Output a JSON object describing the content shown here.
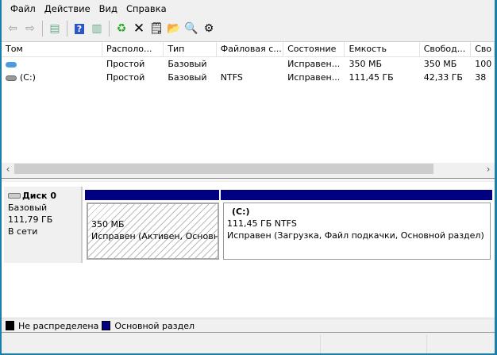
{
  "menu": [
    "Файл",
    "Действие",
    "Вид",
    "Справка"
  ],
  "toolbar": [
    {
      "icon": "back-icon"
    },
    {
      "icon": "forward-icon"
    },
    {
      "icon": "console-tree-icon"
    },
    {
      "icon": "help-icon"
    },
    {
      "icon": "action-pane-icon"
    },
    {
      "icon": "refresh-icon"
    },
    {
      "icon": "delete-icon"
    },
    {
      "icon": "properties-icon"
    },
    {
      "icon": "open-folder-icon"
    },
    {
      "icon": "search-disk-icon"
    },
    {
      "icon": "settings-icon"
    }
  ],
  "columns": [
    "Том",
    "Располо...",
    "Тип",
    "Файловая с...",
    "Состояние",
    "Емкость",
    "Свобод...",
    "Сво"
  ],
  "rows": [
    {
      "cells": [
        "",
        "Простой",
        "Базовый",
        "",
        "Исправен...",
        "350 МБ",
        "350 МБ",
        "100"
      ]
    },
    {
      "cells": [
        "(C:)",
        "Простой",
        "Базовый",
        "NTFS",
        "Исправен...",
        "111,45 ГБ",
        "42,33 ГБ",
        "38"
      ]
    }
  ],
  "disk": {
    "name": "Диск 0",
    "type": "Базовый",
    "size": "111,79 ГБ",
    "status": "В сети"
  },
  "partitions": [
    {
      "title": "",
      "size": "350 МБ",
      "status": "Исправен (Активен, Основной раздел)"
    },
    {
      "title": "(C:)",
      "size": "111,45 ГБ NTFS",
      "status": "Исправен (Загрузка, Файл подкачки, Основной раздел)"
    }
  ],
  "legend": [
    {
      "label": "Не распределена",
      "color": "#000000"
    },
    {
      "label": "Основной раздел",
      "color": "#000080"
    }
  ],
  "colors": {
    "primary": "#000080",
    "frame": "#1b7ea8"
  }
}
